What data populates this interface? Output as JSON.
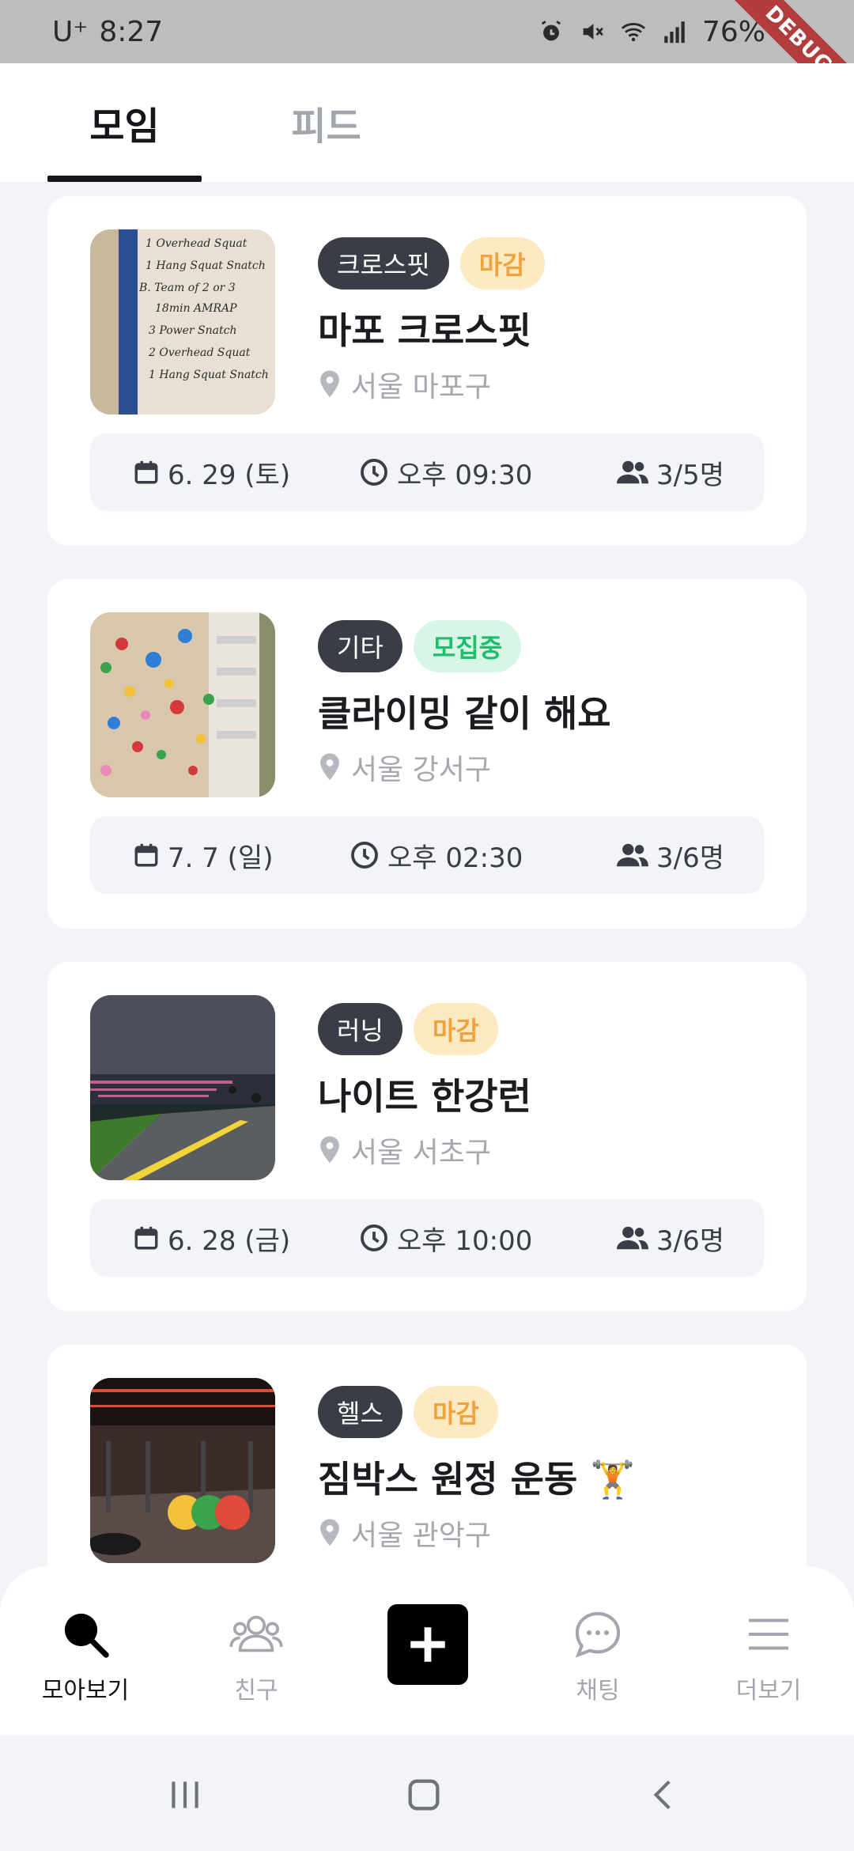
{
  "status_bar": {
    "carrier": "U⁺",
    "time": "8:27",
    "battery": "76%",
    "debug_label": "DEBUG"
  },
  "tabs": [
    {
      "label": "모임",
      "active": true
    },
    {
      "label": "피드",
      "active": false
    }
  ],
  "meetups": [
    {
      "category": "크로스핏",
      "status": "마감",
      "status_type": "closed",
      "title": "마포 크로스핏",
      "location": "서울 마포구",
      "date": "6. 29 (토)",
      "time": "오후 09:30",
      "members": "3/5명",
      "image": "whiteboard-workout-photo",
      "image_text": [
        "1 Overhead Squat",
        "1 Hang Squat Snatch",
        "B. Team of 2 or 3",
        "18min AMRAP",
        "3 Power Snatch",
        "2 Overhead Squat",
        "1 Hang Squat Snatch"
      ]
    },
    {
      "category": "기타",
      "status": "모집중",
      "status_type": "open",
      "title": "클라이밍 같이 해요",
      "location": "서울 강서구",
      "date": "7. 7 (일)",
      "time": "오후 02:30",
      "members": "3/6명",
      "image": "climbing-wall-photo"
    },
    {
      "category": "러닝",
      "status": "마감",
      "status_type": "closed",
      "title": "나이트 한강런",
      "location": "서울 서초구",
      "date": "6. 28 (금)",
      "time": "오후 10:00",
      "members": "3/6명",
      "image": "night-river-photo"
    },
    {
      "category": "헬스",
      "status": "마감",
      "status_type": "closed",
      "title": "짐박스 원정 운동 🏋️",
      "location": "서울 관악구",
      "image": "gym-photo"
    }
  ],
  "bottom_nav": [
    {
      "label": "모아보기",
      "icon": "search-icon",
      "active": true
    },
    {
      "label": "친구",
      "icon": "friends-icon",
      "active": false
    },
    {
      "label": "",
      "icon": "plus-icon",
      "active": false
    },
    {
      "label": "채팅",
      "icon": "chat-icon",
      "active": false
    },
    {
      "label": "더보기",
      "icon": "menu-icon",
      "active": false
    }
  ],
  "colors": {
    "accent": "#15161a",
    "closed_badge_bg": "#fde9c2",
    "closed_badge_text": "#f2a23a",
    "open_badge_bg": "#d8f6e6",
    "open_badge_text": "#1cc06c",
    "category_badge_bg": "#3a3d46"
  }
}
